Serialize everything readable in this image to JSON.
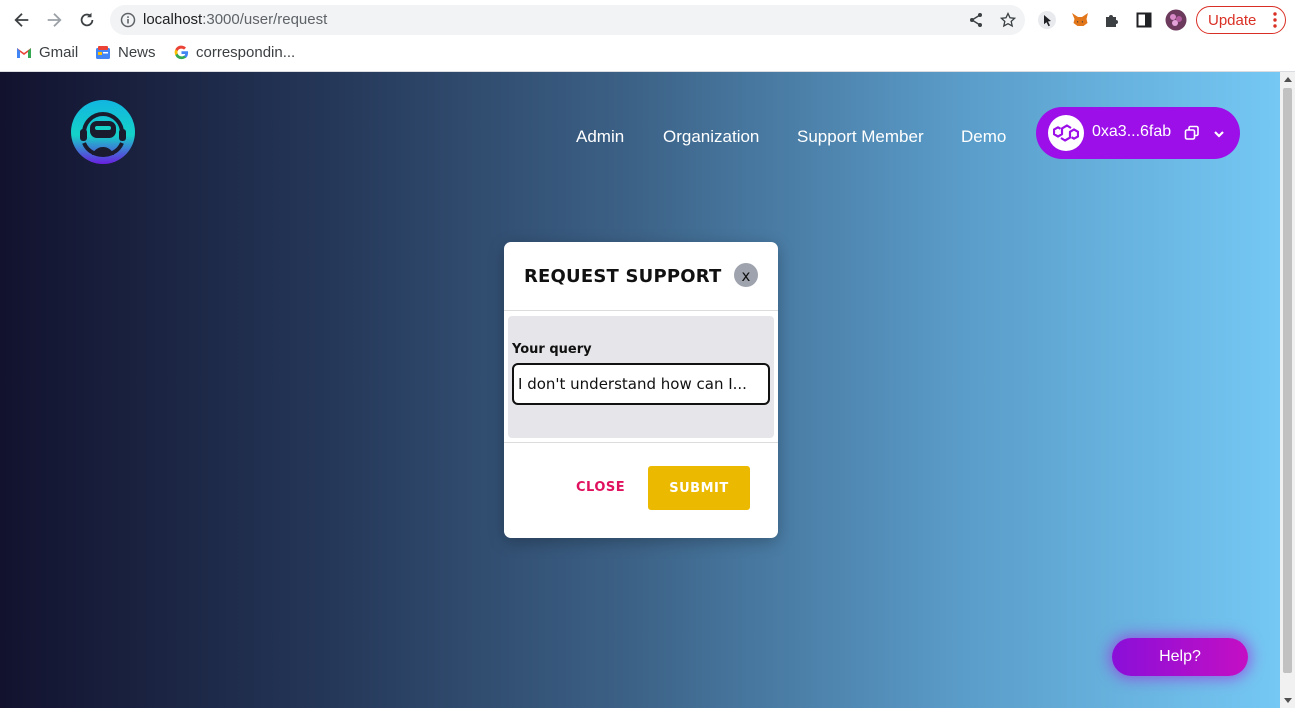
{
  "browser": {
    "url_host": "localhost",
    "url_path": ":3000/user/request",
    "update_label": "Update",
    "bookmarks": [
      {
        "label": "Gmail",
        "icon": "gmail-icon"
      },
      {
        "label": "News",
        "icon": "news-icon"
      },
      {
        "label": "correspondin...",
        "icon": "google-icon"
      }
    ]
  },
  "header": {
    "nav": [
      "Admin",
      "Organization",
      "Support Member",
      "Demo"
    ],
    "wallet_address": "0xa3...6fab"
  },
  "modal": {
    "title": "REQUEST SUPPORT",
    "close_x": "x",
    "query_label": "Your query",
    "query_value": "I don't understand how can I...",
    "close_label": "CLOSE",
    "submit_label": "SUBMIT"
  },
  "help_label": "Help?",
  "colors": {
    "wallet": "#9c0fe8",
    "submit": "#ebba00",
    "close": "#e0115f",
    "update": "#d93025"
  }
}
